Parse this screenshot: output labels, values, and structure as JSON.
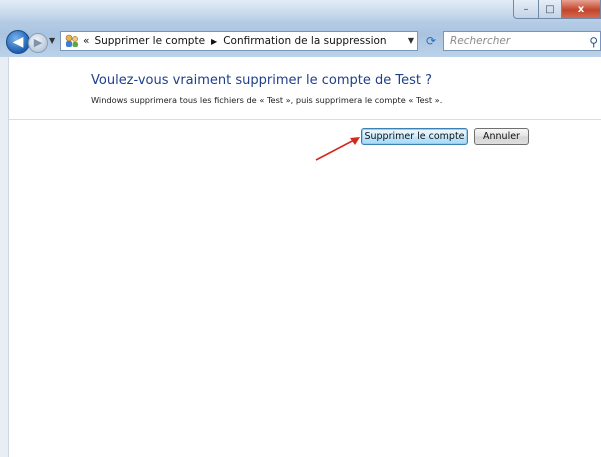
{
  "window": {
    "caption_buttons": {
      "minimize": "–",
      "maximize": "□",
      "close": "x"
    }
  },
  "nav": {
    "back_icon": "back-arrow-icon",
    "forward_icon": "forward-arrow-icon",
    "overflow_marker": "«",
    "breadcrumb": [
      "Supprimer le compte",
      "Confirmation de la suppression"
    ],
    "separator": "▶",
    "search_placeholder": "Rechercher"
  },
  "content": {
    "heading": "Voulez-vous vraiment supprimer le compte de Test ?",
    "description": "Windows supprimera tous les fichiers de « Test », puis supprimera le compte « Test ».",
    "buttons": {
      "delete_label": "Supprimer le compte",
      "cancel_label": "Annuler"
    }
  },
  "colors": {
    "heading": "#1e3f8a",
    "annotation_arrow": "#d42a1e"
  }
}
